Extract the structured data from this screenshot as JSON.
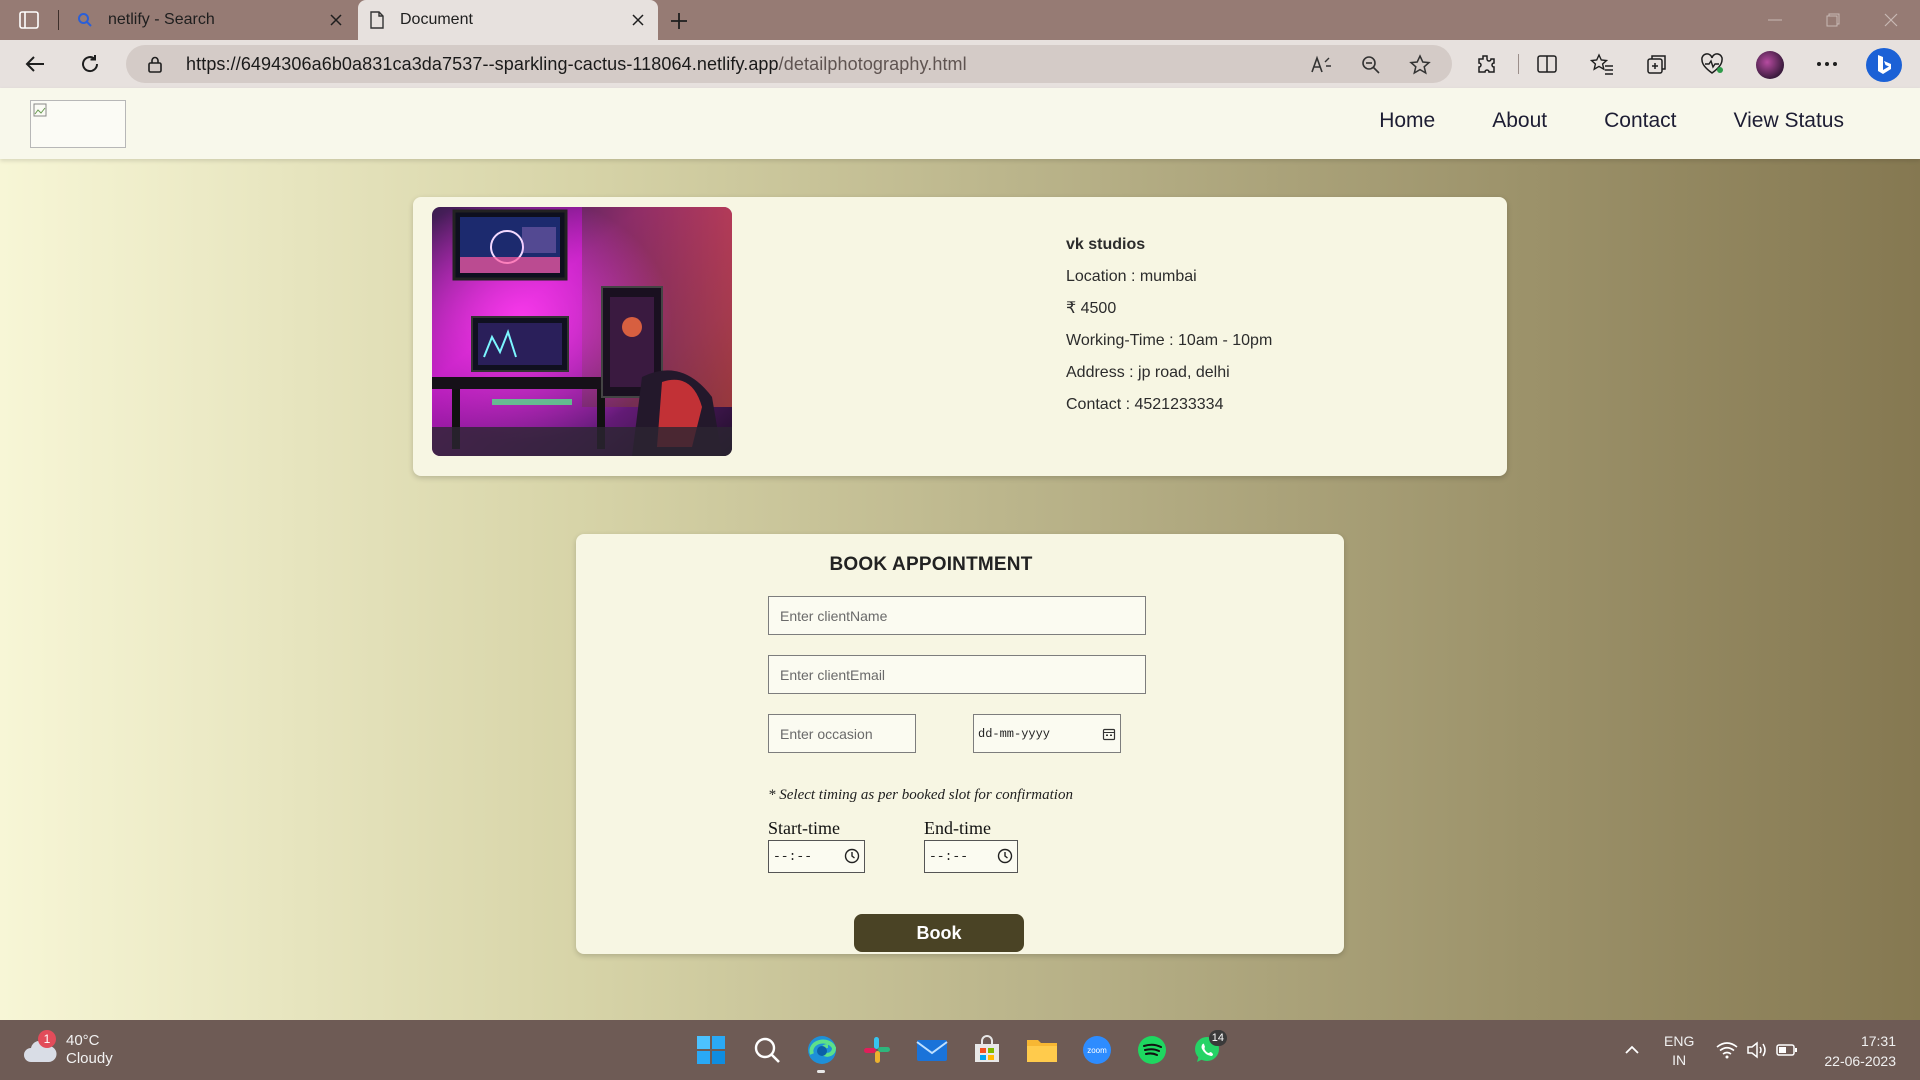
{
  "browser": {
    "tabs": [
      {
        "label": "netlify - Search",
        "icon": "search-icon",
        "active": false
      },
      {
        "label": "Document",
        "icon": "document-icon",
        "active": true
      }
    ],
    "url_main": "https://6494306a6b0a831ca3da7537--sparkling-cactus-118064.netlify.app",
    "url_path": "/detailphotography.html"
  },
  "site": {
    "nav": [
      {
        "label": "Home"
      },
      {
        "label": "About"
      },
      {
        "label": "Contact"
      },
      {
        "label": "View Status"
      }
    ],
    "studio": {
      "name": "vk studios",
      "location": "Location : mumbai",
      "price": "₹ 4500",
      "working_time": "Working-Time : 10am - 10pm",
      "address": "Address : jp road, delhi",
      "contact": "Contact : 4521233334"
    },
    "booking": {
      "title": "BOOK APPOINTMENT",
      "name_placeholder": "Enter clientName",
      "email_placeholder": "Enter clientEmail",
      "occasion_placeholder": "Enter occasion",
      "date_value": "dd-mm-yyyy",
      "note": "* Select timing as per booked slot for confirmation",
      "start_label": "Start-time",
      "end_label": "End-time",
      "time_value": "--:--",
      "book_label": "Book"
    }
  },
  "taskbar": {
    "weather_temp": "40°C",
    "weather_desc": "Cloudy",
    "weather_badge": "1",
    "whatsapp_badge": "14",
    "lang_line1": "ENG",
    "lang_line2": "IN",
    "time": "17:31",
    "date": "22-06-2023"
  },
  "colors": {
    "button_bg": "#4a4325",
    "nav_bg": "#f8f8eb",
    "card_bg": "#f7f6e3",
    "tabbar_bg": "#967b74",
    "taskbar_bg": "#6e5b55"
  }
}
